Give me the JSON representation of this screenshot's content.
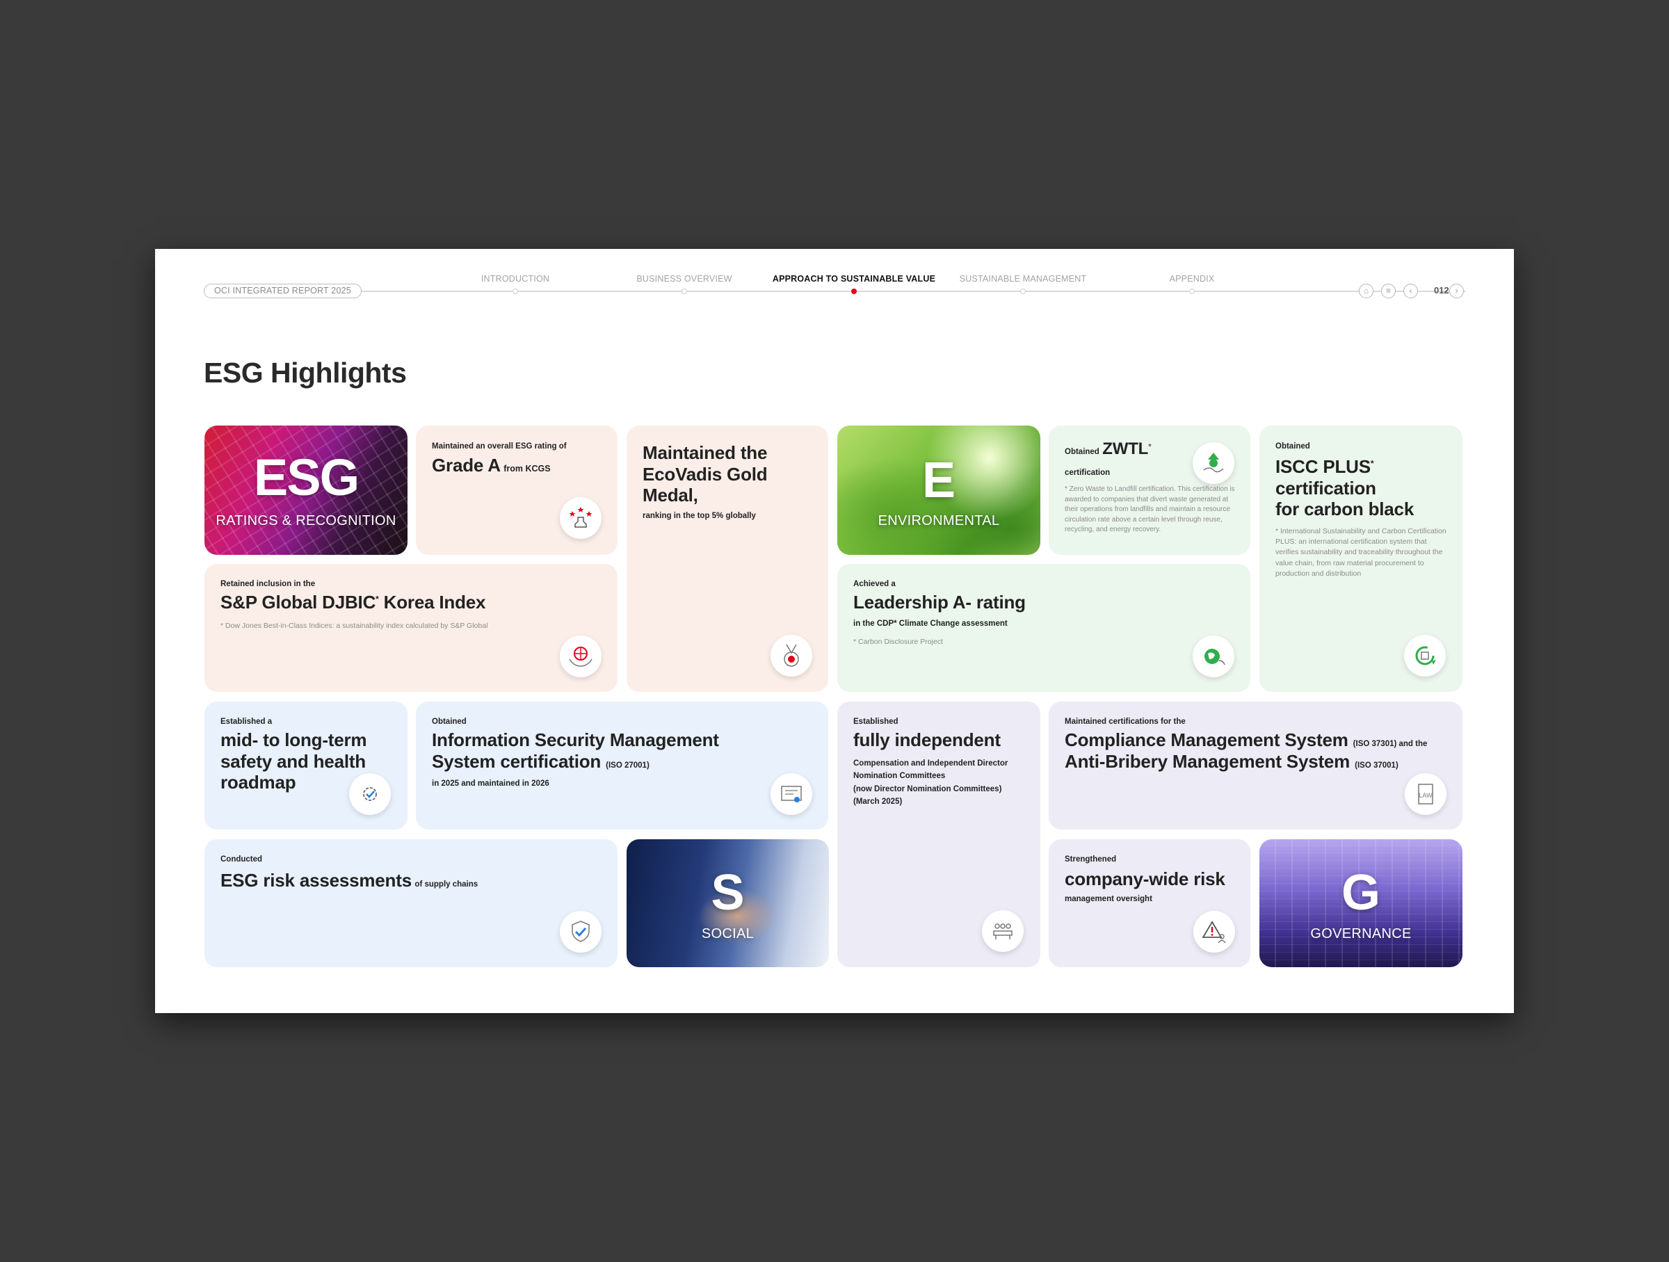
{
  "header": {
    "report_title": "OCI INTEGRATED REPORT 2025",
    "nav": [
      {
        "label": "INTRODUCTION",
        "active": false
      },
      {
        "label": "BUSINESS OVERVIEW",
        "active": false
      },
      {
        "label": "APPROACH TO SUSTAINABLE VALUE",
        "active": true
      },
      {
        "label": "SUSTAINABLE MANAGEMENT",
        "active": false
      },
      {
        "label": "APPENDIX",
        "active": false
      }
    ],
    "page_number": "012",
    "icons": [
      "home-icon",
      "menu-icon",
      "prev-page-icon",
      "next-page-icon"
    ]
  },
  "page_title": "ESG Highlights",
  "tiles": {
    "esg": {
      "letter": "ESG",
      "caption": "RATINGS & RECOGNITION"
    },
    "environmental": {
      "letter": "E",
      "caption": "ENVIRONMENTAL"
    },
    "social": {
      "letter": "S",
      "caption": "SOCIAL"
    },
    "governance": {
      "letter": "G",
      "caption": "GOVERNANCE"
    }
  },
  "cards": {
    "grade_a": {
      "pre": "Maintained an overall ESG rating of",
      "main": "Grade A",
      "post": "from KCGS",
      "icon": "stamp-stars-icon"
    },
    "ecovadis": {
      "main": "Maintained the EcoVadis Gold Medal,",
      "sub": "ranking in the top 5% globally",
      "icon": "medal-icon"
    },
    "zwtl": {
      "pre": "Obtained",
      "main": "ZWTL",
      "sup": "*",
      "post": "certification",
      "note": "* Zero Waste to Landfill certification. This certification is awarded to companies that divert waste generated at their operations from landfills and maintain a resource circulation rate above a certain level through reuse, recycling, and energy recovery.",
      "icon": "recycle-hand-icon"
    },
    "iscc": {
      "pre": "Obtained",
      "main1": "ISCC PLUS",
      "sup": "*",
      "main2": "certification",
      "main3": "for carbon black",
      "note": "* International Sustainability and Carbon Certification PLUS: an international certification system that verifies sustainability and traceability throughout the value chain, from raw material procurement to production and distribution",
      "icon": "circular-arrow-icon"
    },
    "djbic": {
      "pre": "Retained inclusion in the",
      "main": "S&P Global DJBIC",
      "sup": "*",
      "main_tail": " Korea Index",
      "note": "* Dow Jones Best-in-Class Indices: a sustainability index calculated by S&P Global",
      "icon": "globe-hands-icon"
    },
    "cdp": {
      "pre": "Achieved a",
      "main": "Leadership A- rating",
      "sub": "in the CDP* Climate Change assessment",
      "note": "* Carbon Disclosure Project",
      "icon": "earth-leaf-icon"
    },
    "safety": {
      "pre": "Established a",
      "main": "mid- to long-term safety and health roadmap",
      "icon": "gear-check-icon"
    },
    "isms": {
      "pre": "Obtained",
      "main1": "Information Security Management",
      "main2": "System certification",
      "main2_small": "(ISO 27001)",
      "sub": "in 2025 and maintained in 2026",
      "icon": "certificate-icon"
    },
    "independent": {
      "pre": "Established",
      "main": "fully independent",
      "sub1": "Compensation and Independent Director",
      "sub2": "Nomination Committees",
      "sub3": "(now Director Nomination Committees)",
      "sub4": "(March 2025)",
      "icon": "committee-icon"
    },
    "compliance": {
      "pre": "Maintained certifications for the",
      "main1": "Compliance Management System",
      "main1_small": "(ISO 37301) and the",
      "main2": "Anti-Bribery Management System",
      "main2_small": "(ISO 37001)",
      "icon": "law-book-icon"
    },
    "risk_assess": {
      "pre": "Conducted",
      "main": "ESG risk assessments",
      "post": "of supply chains",
      "icon": "shield-check-icon"
    },
    "risk_mgmt": {
      "pre": "Strengthened",
      "main": "company-wide risk",
      "sub": "management oversight",
      "icon": "warning-person-icon"
    }
  },
  "colors": {
    "accent_red": "#e3001b",
    "peach": "#fbeee8",
    "mint": "#ebf6ec",
    "blue": "#e8f1fc",
    "lavender": "#ecebf6"
  }
}
